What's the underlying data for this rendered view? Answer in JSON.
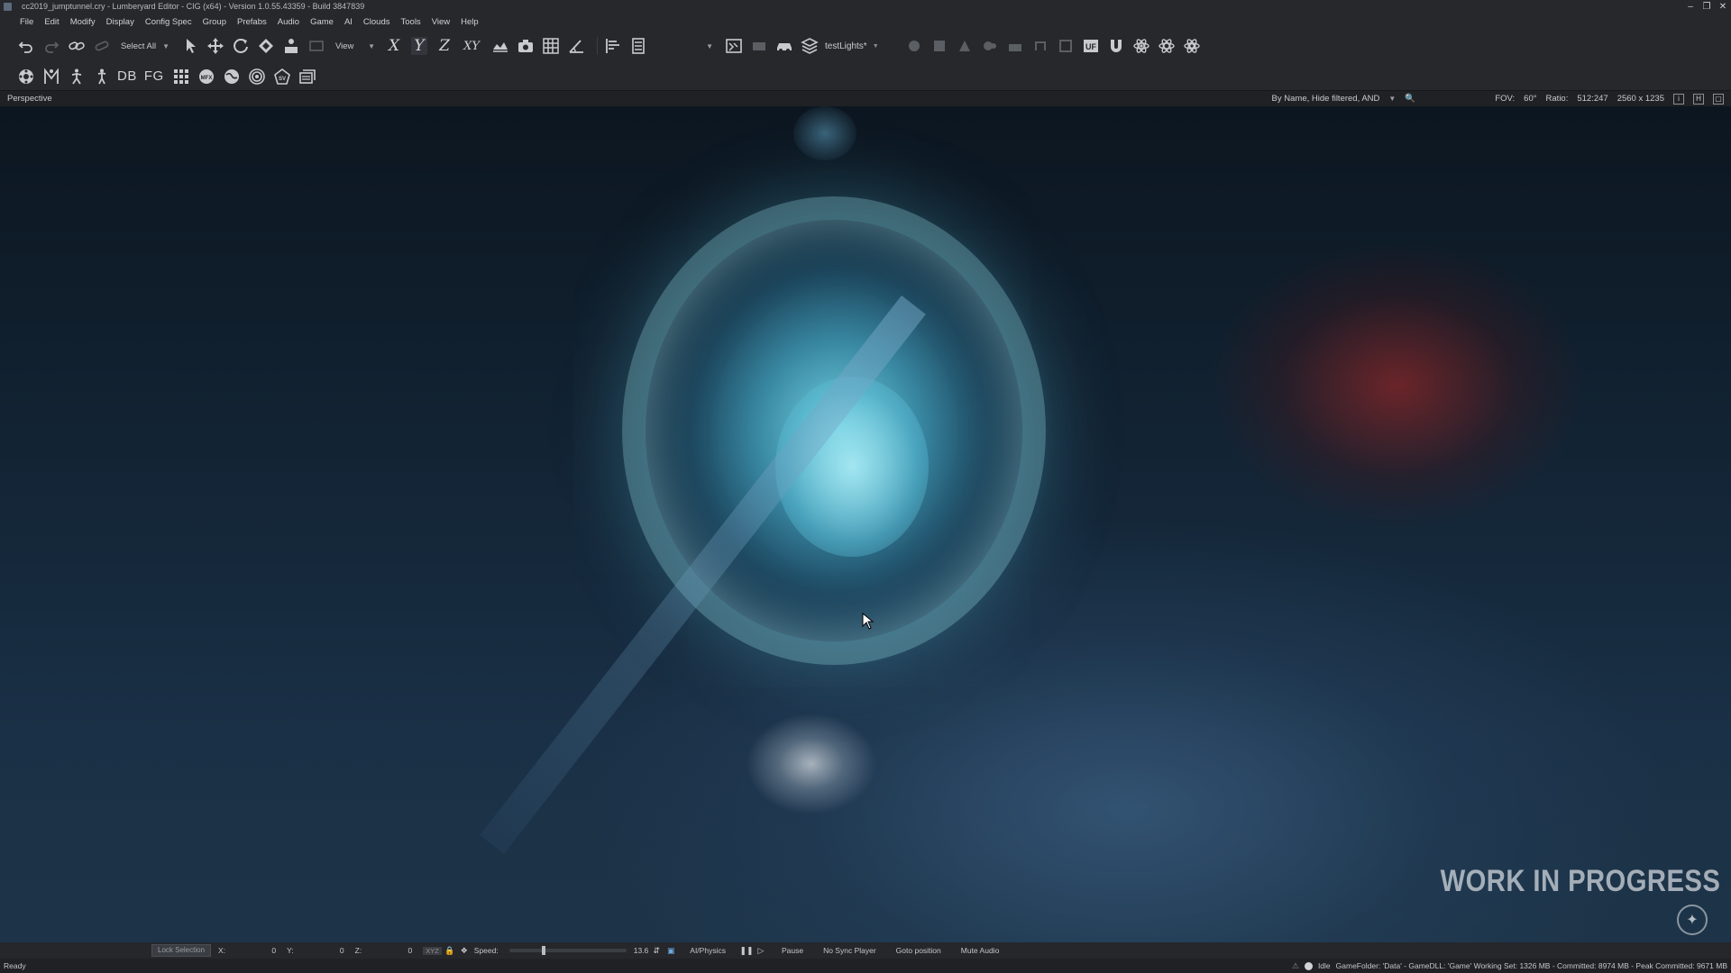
{
  "window": {
    "title": "cc2019_jumptunnel.cry - Lumberyard Editor - CIG (x64) - Version 1.0.55.43359 - Build 3847839",
    "controls": [
      "minimize",
      "restore",
      "close"
    ]
  },
  "menu": {
    "items": [
      "File",
      "Edit",
      "Modify",
      "Display",
      "Config Spec",
      "Group",
      "Prefabs",
      "Audio",
      "Game",
      "AI",
      "Clouds",
      "Tools",
      "View",
      "Help"
    ]
  },
  "toolbar": {
    "select_all": "Select All",
    "view_dropdown": "View",
    "axis_x": "X",
    "axis_y": "Y",
    "axis_z": "Z",
    "axis_xy": "XY",
    "layer_name": "testLights*",
    "row2_db": "DB",
    "row2_fg": "FG"
  },
  "viewport": {
    "name": "Perspective",
    "filter_text": "By Name, Hide filtered, AND",
    "fov_label": "FOV:",
    "fov_value": "60°",
    "ratio_label": "Ratio:",
    "ratio_value": "512:247",
    "resolution": "2560 x 1235",
    "watermark": "WORK IN PROGRESS"
  },
  "bottombar": {
    "lock_selection": "Lock Selection",
    "x_label": "X:",
    "x_value": "0",
    "y_label": "Y:",
    "y_value": "0",
    "z_label": "Z:",
    "z_value": "0",
    "xyz_badge": "XYZ",
    "speed_label": "Speed:",
    "speed_value": "13.6",
    "speed_fraction": 0.28,
    "ai_physics": "AI/Physics",
    "pause": "Pause",
    "no_sync_player": "No Sync Player",
    "goto_position": "Goto position",
    "mute_audio": "Mute Audio"
  },
  "statusbar": {
    "left": "Ready",
    "idle": "Idle",
    "info": "GameFolder: 'Data' - GameDLL: 'Game'   Working Set: 1326 MB - Committed: 8974 MB - Peak Committed: 9671 MB"
  }
}
